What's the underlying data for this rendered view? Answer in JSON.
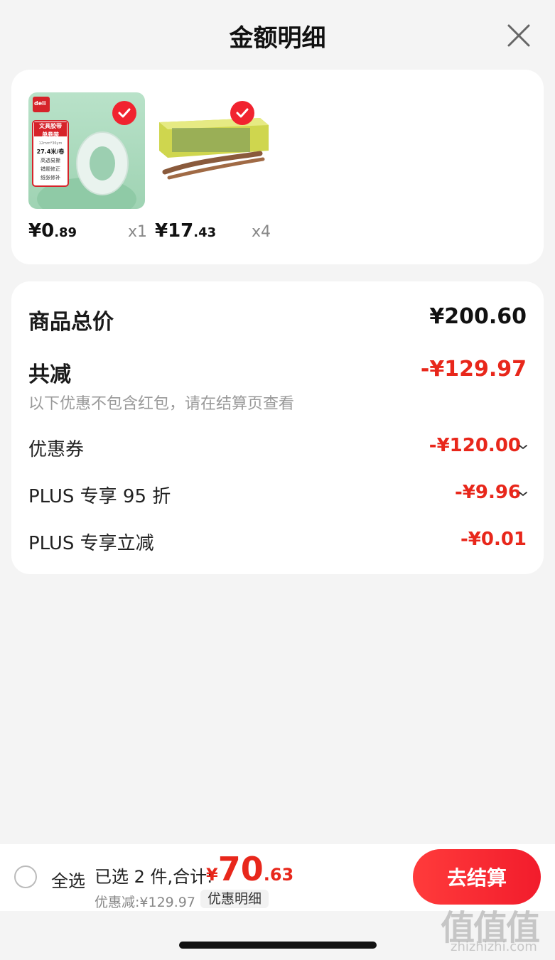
{
  "header": {
    "title": "金额明细"
  },
  "products": [
    {
      "price_int": "¥0",
      "price_dec": ".89",
      "quantity": "x1",
      "brand_label": "deli",
      "package_lines": [
        "文具胶带",
        "单卷装",
        "12mm*36ym",
        "27.4米/卷",
        "高透易撕",
        "错题修正",
        "纸张修补"
      ]
    },
    {
      "price_int": "¥17",
      "price_dec": ".43",
      "quantity": "x4"
    }
  ],
  "summary": {
    "total_label": "商品总价",
    "total_value": "¥200.60",
    "reduce_label": "共减",
    "reduce_value": "-¥129.97",
    "note": "以下优惠不包含红包，请在结算页查看",
    "items": [
      {
        "label": "优惠券",
        "value": "-¥120.00"
      },
      {
        "label": "PLUS 专享 95 折",
        "value": "-¥9.96"
      },
      {
        "label": "PLUS 专享立减",
        "value": "-¥0.01"
      }
    ]
  },
  "bottom": {
    "select_all": "全选",
    "selected_text": "已选 2 件,合计:",
    "total_yen": "¥",
    "total_int": "70",
    "total_dec": ".63",
    "discount_text": "优惠减:¥129.97",
    "detail_label": "优惠明细",
    "checkout_label": "去结算"
  },
  "watermark": {
    "big": "值值值",
    "small": "zhizhizhi.com"
  },
  "colors": {
    "accent_red": "#e8271b",
    "badge_red": "#f1232f",
    "background": "#f4f4f4"
  }
}
